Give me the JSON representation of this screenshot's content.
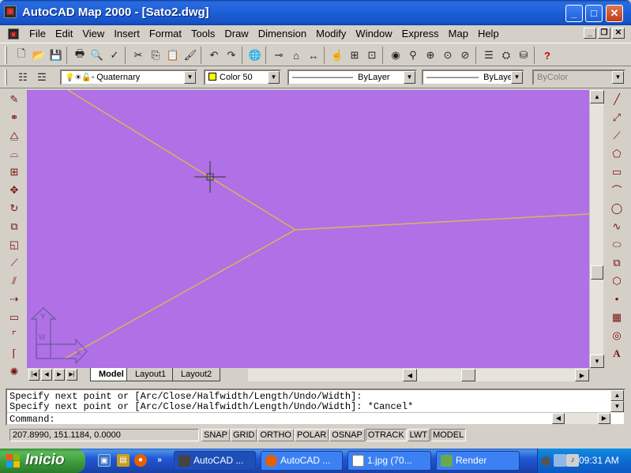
{
  "window": {
    "title": "AutoCAD Map 2000 - [Sato2.dwg]",
    "minimize": "_",
    "maximize": "□",
    "close": "✕"
  },
  "menu": {
    "items": [
      "File",
      "Edit",
      "View",
      "Insert",
      "Format",
      "Tools",
      "Draw",
      "Dimension",
      "Modify",
      "Window",
      "Express",
      "Map",
      "Help"
    ]
  },
  "layer_toolbar": {
    "layer": "Quaternary",
    "color": "Color 50",
    "linetype": "ByLayer",
    "lineweight": "ByLayer",
    "plotstyle": "ByColor"
  },
  "colors": {
    "drawing_background": "#b070e6",
    "polyline": "#ddb45a",
    "layer_color_swatch": "#ffff00"
  },
  "tabs": {
    "model": "Model",
    "layout1": "Layout1",
    "layout2": "Layout2"
  },
  "command": {
    "line1": "Specify next point or [Arc/Close/Halfwidth/Length/Undo/Width]:",
    "line2": "Specify next point or [Arc/Close/Halfwidth/Length/Undo/Width]: *Cancel*",
    "prompt": "Command:"
  },
  "status": {
    "coordinates": "207.8990, 151.1184, 0.0000",
    "toggles": [
      {
        "label": "SNAP",
        "on": false
      },
      {
        "label": "GRID",
        "on": false
      },
      {
        "label": "ORTHO",
        "on": false
      },
      {
        "label": "POLAR",
        "on": false
      },
      {
        "label": "OSNAP",
        "on": false
      },
      {
        "label": "OTRACK",
        "on": true
      },
      {
        "label": "LWT",
        "on": false
      },
      {
        "label": "MODEL",
        "on": true
      }
    ]
  },
  "ucs": {
    "y": "Y",
    "x": "X",
    "w": "W"
  },
  "taskbar": {
    "start": "Inicio",
    "tasks": [
      "AutoCAD ...",
      "AutoCAD ...",
      "1.jpg (70...",
      "Render"
    ],
    "clock": "09:31 AM"
  }
}
